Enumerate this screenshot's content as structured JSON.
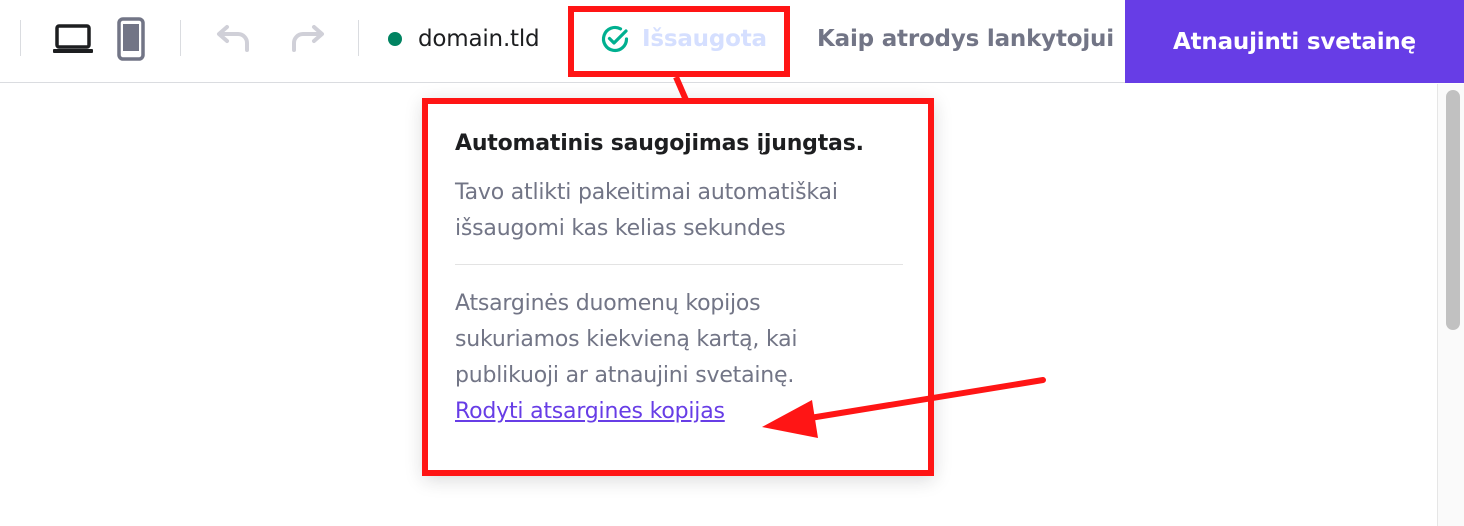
{
  "toolbar": {
    "domain": "domain.tld",
    "saved_label": "Išsaugota",
    "preview_label": "Kaip atrodys lankytojui",
    "update_button": "Atnaujinti svetainę",
    "icons": {
      "desktop": "laptop-icon",
      "mobile": "phone-icon",
      "undo": "undo-icon",
      "redo": "redo-icon",
      "saved": "check-circle-icon"
    }
  },
  "popover": {
    "title": "Automatinis saugojimas įjungtas.",
    "text1": "Tavo atlikti pakeitimai automatiškai išsaugomi kas kelias sekundes",
    "text2": "Atsarginės duomenų kopijos sukuriamos kiekvieną kartą, kai publikuoji ar atnaujini svetainę.",
    "link": "Rodyti atsargines kopijas"
  },
  "colors": {
    "accent": "#673de6",
    "status_dot": "#008361",
    "saved_check": "#00b090",
    "annotation": "#ff1515"
  }
}
